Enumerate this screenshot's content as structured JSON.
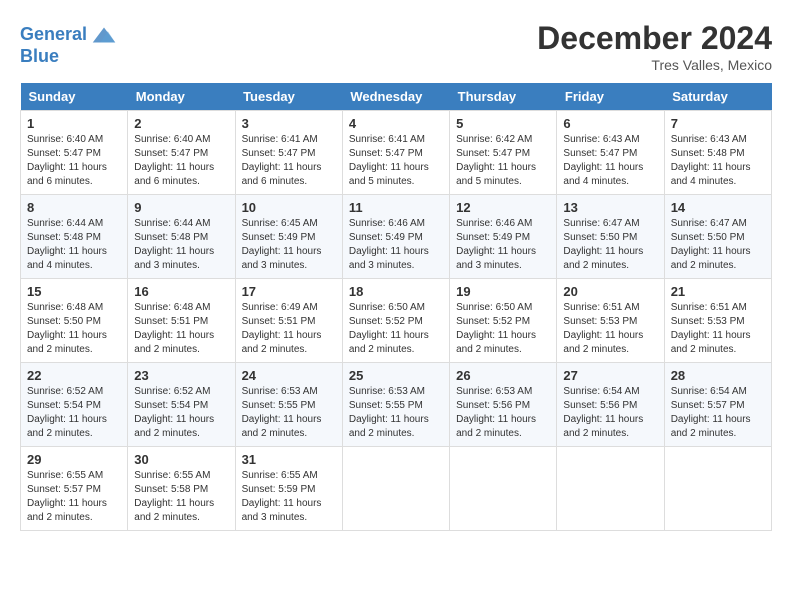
{
  "header": {
    "logo_line1": "General",
    "logo_line2": "Blue",
    "month": "December 2024",
    "location": "Tres Valles, Mexico"
  },
  "weekdays": [
    "Sunday",
    "Monday",
    "Tuesday",
    "Wednesday",
    "Thursday",
    "Friday",
    "Saturday"
  ],
  "weeks": [
    [
      {
        "day": "1",
        "sunrise": "6:40 AM",
        "sunset": "5:47 PM",
        "daylight": "11 hours and 6 minutes."
      },
      {
        "day": "2",
        "sunrise": "6:40 AM",
        "sunset": "5:47 PM",
        "daylight": "11 hours and 6 minutes."
      },
      {
        "day": "3",
        "sunrise": "6:41 AM",
        "sunset": "5:47 PM",
        "daylight": "11 hours and 6 minutes."
      },
      {
        "day": "4",
        "sunrise": "6:41 AM",
        "sunset": "5:47 PM",
        "daylight": "11 hours and 5 minutes."
      },
      {
        "day": "5",
        "sunrise": "6:42 AM",
        "sunset": "5:47 PM",
        "daylight": "11 hours and 5 minutes."
      },
      {
        "day": "6",
        "sunrise": "6:43 AM",
        "sunset": "5:47 PM",
        "daylight": "11 hours and 4 minutes."
      },
      {
        "day": "7",
        "sunrise": "6:43 AM",
        "sunset": "5:48 PM",
        "daylight": "11 hours and 4 minutes."
      }
    ],
    [
      {
        "day": "8",
        "sunrise": "6:44 AM",
        "sunset": "5:48 PM",
        "daylight": "11 hours and 4 minutes."
      },
      {
        "day": "9",
        "sunrise": "6:44 AM",
        "sunset": "5:48 PM",
        "daylight": "11 hours and 3 minutes."
      },
      {
        "day": "10",
        "sunrise": "6:45 AM",
        "sunset": "5:49 PM",
        "daylight": "11 hours and 3 minutes."
      },
      {
        "day": "11",
        "sunrise": "6:46 AM",
        "sunset": "5:49 PM",
        "daylight": "11 hours and 3 minutes."
      },
      {
        "day": "12",
        "sunrise": "6:46 AM",
        "sunset": "5:49 PM",
        "daylight": "11 hours and 3 minutes."
      },
      {
        "day": "13",
        "sunrise": "6:47 AM",
        "sunset": "5:50 PM",
        "daylight": "11 hours and 2 minutes."
      },
      {
        "day": "14",
        "sunrise": "6:47 AM",
        "sunset": "5:50 PM",
        "daylight": "11 hours and 2 minutes."
      }
    ],
    [
      {
        "day": "15",
        "sunrise": "6:48 AM",
        "sunset": "5:50 PM",
        "daylight": "11 hours and 2 minutes."
      },
      {
        "day": "16",
        "sunrise": "6:48 AM",
        "sunset": "5:51 PM",
        "daylight": "11 hours and 2 minutes."
      },
      {
        "day": "17",
        "sunrise": "6:49 AM",
        "sunset": "5:51 PM",
        "daylight": "11 hours and 2 minutes."
      },
      {
        "day": "18",
        "sunrise": "6:50 AM",
        "sunset": "5:52 PM",
        "daylight": "11 hours and 2 minutes."
      },
      {
        "day": "19",
        "sunrise": "6:50 AM",
        "sunset": "5:52 PM",
        "daylight": "11 hours and 2 minutes."
      },
      {
        "day": "20",
        "sunrise": "6:51 AM",
        "sunset": "5:53 PM",
        "daylight": "11 hours and 2 minutes."
      },
      {
        "day": "21",
        "sunrise": "6:51 AM",
        "sunset": "5:53 PM",
        "daylight": "11 hours and 2 minutes."
      }
    ],
    [
      {
        "day": "22",
        "sunrise": "6:52 AM",
        "sunset": "5:54 PM",
        "daylight": "11 hours and 2 minutes."
      },
      {
        "day": "23",
        "sunrise": "6:52 AM",
        "sunset": "5:54 PM",
        "daylight": "11 hours and 2 minutes."
      },
      {
        "day": "24",
        "sunrise": "6:53 AM",
        "sunset": "5:55 PM",
        "daylight": "11 hours and 2 minutes."
      },
      {
        "day": "25",
        "sunrise": "6:53 AM",
        "sunset": "5:55 PM",
        "daylight": "11 hours and 2 minutes."
      },
      {
        "day": "26",
        "sunrise": "6:53 AM",
        "sunset": "5:56 PM",
        "daylight": "11 hours and 2 minutes."
      },
      {
        "day": "27",
        "sunrise": "6:54 AM",
        "sunset": "5:56 PM",
        "daylight": "11 hours and 2 minutes."
      },
      {
        "day": "28",
        "sunrise": "6:54 AM",
        "sunset": "5:57 PM",
        "daylight": "11 hours and 2 minutes."
      }
    ],
    [
      {
        "day": "29",
        "sunrise": "6:55 AM",
        "sunset": "5:57 PM",
        "daylight": "11 hours and 2 minutes."
      },
      {
        "day": "30",
        "sunrise": "6:55 AM",
        "sunset": "5:58 PM",
        "daylight": "11 hours and 2 minutes."
      },
      {
        "day": "31",
        "sunrise": "6:55 AM",
        "sunset": "5:59 PM",
        "daylight": "11 hours and 3 minutes."
      },
      null,
      null,
      null,
      null
    ]
  ]
}
